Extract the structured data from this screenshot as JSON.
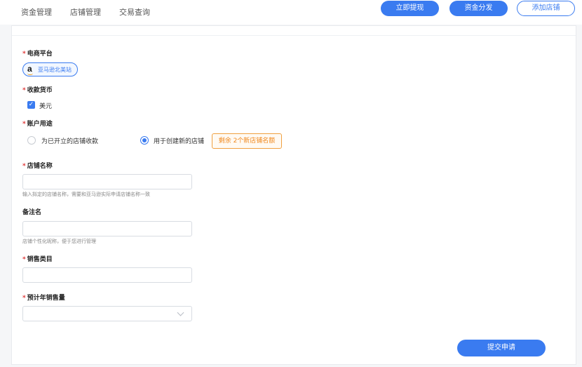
{
  "nav": {
    "items": [
      "资金管理",
      "店铺管理",
      "交易查询"
    ]
  },
  "actions": {
    "withdraw": "立即提现",
    "distribute": "资金分发",
    "add_store": "添加店铺"
  },
  "form": {
    "platform": {
      "label": "电商平台",
      "selected": "亚马逊北美站",
      "icon": "amazon-logo-icon"
    },
    "currency": {
      "label": "收款货币",
      "option": "美元",
      "checked": true
    },
    "purpose": {
      "label": "账户用途",
      "options": [
        "为已开立的店铺收款",
        "用于创建新的店铺"
      ],
      "selected_index": 1,
      "quota_badge": "剩余 2个新店铺名额"
    },
    "store_name": {
      "label": "店铺名称",
      "value": "",
      "hint": "输入拟定的店铺名称，需要和亚马逊实际申请店铺名称一致"
    },
    "remark": {
      "label": "备注名",
      "value": "",
      "hint": "店铺个性化昵称，便于您进行管理"
    },
    "category": {
      "label": "销售类目",
      "value": ""
    },
    "annual_sales": {
      "label": "预计年销售量",
      "value": ""
    },
    "submit_label": "提交申请"
  },
  "colors": {
    "primary": "#3a7bf0",
    "required": "#e03a3a",
    "quota": "#f08a20"
  }
}
